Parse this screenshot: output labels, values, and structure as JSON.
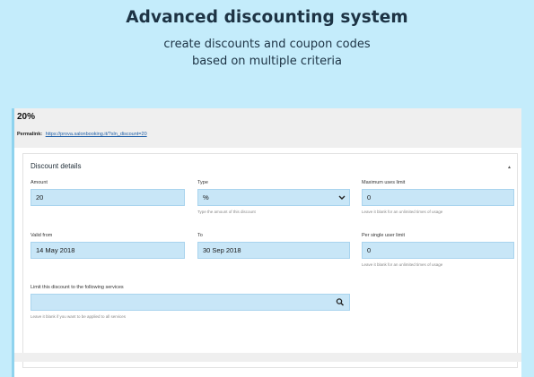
{
  "hero": {
    "title": "Advanced discounting system",
    "subtitle_line1": "create discounts and coupon codes",
    "subtitle_line2": "based on multiple criteria"
  },
  "post": {
    "title": "20%",
    "permalink_label": "Permalink:",
    "permalink_url": "https://prova.salonbooking.it/?sln_discount=20"
  },
  "discount_box": {
    "title": "Discount details",
    "amount": {
      "label": "Amount",
      "value": "20"
    },
    "type": {
      "label": "Type",
      "value": "%",
      "help": "Type the amount of this discount"
    },
    "max_uses": {
      "label": "Maximum uses limit",
      "value": "0",
      "help": "Leave it blank for an unlimited times of usage"
    },
    "valid_from": {
      "label": "Valid from",
      "value": "14 May 2018"
    },
    "to": {
      "label": "To",
      "value": "30 Sep 2018"
    },
    "per_user": {
      "label": "Per single user limit",
      "value": "0",
      "help": "Leave it blank for an unlimited times of usage"
    },
    "services": {
      "label": "Limit this discount to the following services",
      "value": "",
      "help": "Leave it blank if you want to be applied to all services"
    }
  },
  "colors": {
    "background": "#c4ecfb",
    "field": "#c8e6f7",
    "title": "#1d3344"
  },
  "icons": {
    "collapse": "caret-up-icon",
    "select": "chevron-down-icon",
    "search": "search-icon"
  }
}
